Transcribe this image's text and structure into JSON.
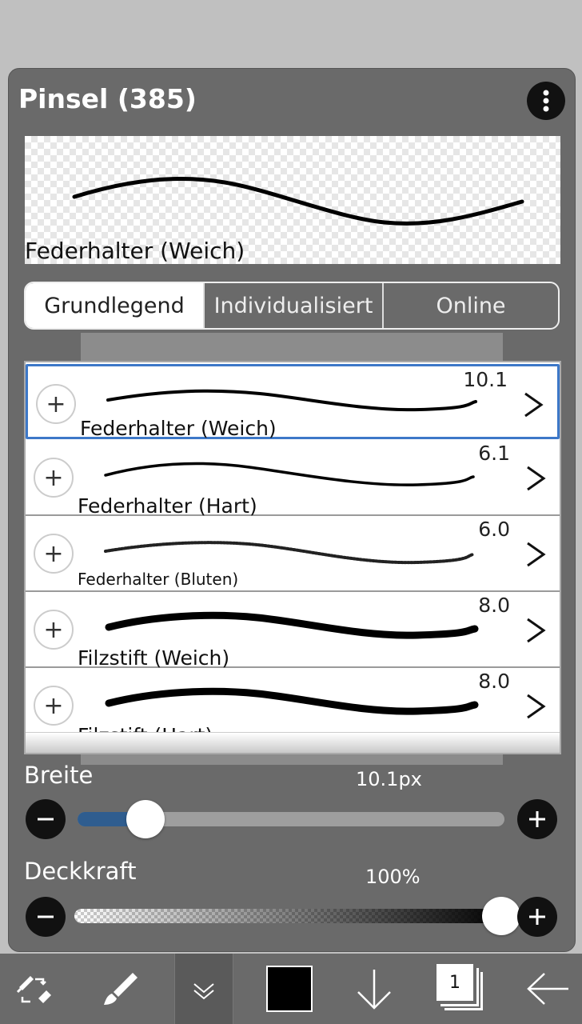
{
  "panel": {
    "title": "Pinsel (385)",
    "more_icon": "vertical-ellipsis-icon"
  },
  "preview": {
    "brush_name": "Federhalter (Weich)"
  },
  "tabs": [
    {
      "label": "Grundlegend",
      "active": true
    },
    {
      "label": "Individualisiert",
      "active": false
    },
    {
      "label": "Online",
      "active": false
    }
  ],
  "brushes": [
    {
      "name": "Federhalter (Weich)",
      "size": "10.1",
      "selected": true
    },
    {
      "name": "Federhalter (Hart)",
      "size": "6.1",
      "selected": false
    },
    {
      "name": "Federhalter (Bluten)",
      "size": "6.0",
      "selected": false
    },
    {
      "name": "Filzstift (Weich)",
      "size": "8.0",
      "selected": false
    },
    {
      "name": "Filzstift (Hart)",
      "size": "8.0",
      "selected": false
    }
  ],
  "width_control": {
    "label": "Breite",
    "value": "10.1px",
    "fraction": 0.16
  },
  "opacity_control": {
    "label": "Deckkraft",
    "value": "100%",
    "fraction": 1.0
  },
  "toolbar": {
    "layer_count": "1",
    "color": "#000000",
    "icons": [
      "swap-eraser-icon",
      "brush-icon",
      "collapse-chevron-icon",
      "color-swatch",
      "arrow-down-icon",
      "layers-icon",
      "back-arrow-icon"
    ]
  },
  "colors": {
    "panel_bg": "#6a6a6a",
    "accent": "#3d78c8",
    "slider_fill": "#2f5d8f"
  }
}
